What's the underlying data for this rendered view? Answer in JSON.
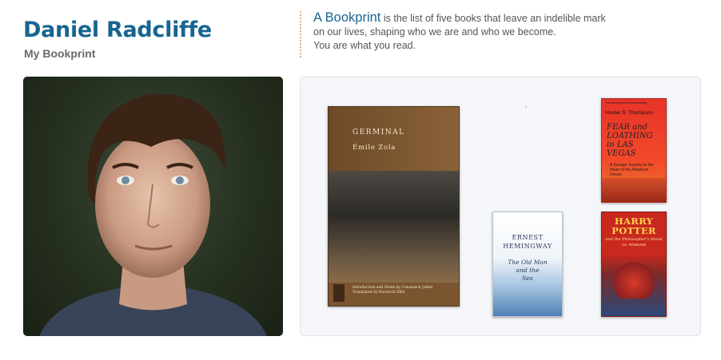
{
  "profile": {
    "name": "Daniel Radcliffe",
    "subtitle": "My Bookprint"
  },
  "intro": {
    "term": "A Bookprint",
    "line1": " is the list of five books that leave an indelible mark",
    "line2": "on our lives, shaping who we are and who we become.",
    "line3": "You are what you read."
  },
  "books": [
    {
      "title": "GERMINAL",
      "author": "Émile Zola",
      "notes": "Introduction and Notes by Constance Jolliet Translated by Havelock Ellis"
    },
    {
      "author_line1": "ERNEST",
      "author_line2": "HEMINGWAY",
      "title_line1": "The Old Man",
      "title_line2": "and the",
      "title_line3": "Sea"
    },
    {
      "tagline": "The first book in the Gonzo trilogy",
      "author": "Hunter S. Thompson",
      "title": "FEAR and LOATHING in LAS VEGAS",
      "subtitle": "A Savage Journey to the Heart of the American Dream"
    },
    {
      "title_line1": "HARRY",
      "title_line2": "POTTER",
      "subtitle": "and the Philosopher's Stone",
      "author": "J.K. ROWLING"
    }
  ],
  "colors": {
    "accent": "#17658f",
    "shelf_bg": "#f4f6f9"
  }
}
